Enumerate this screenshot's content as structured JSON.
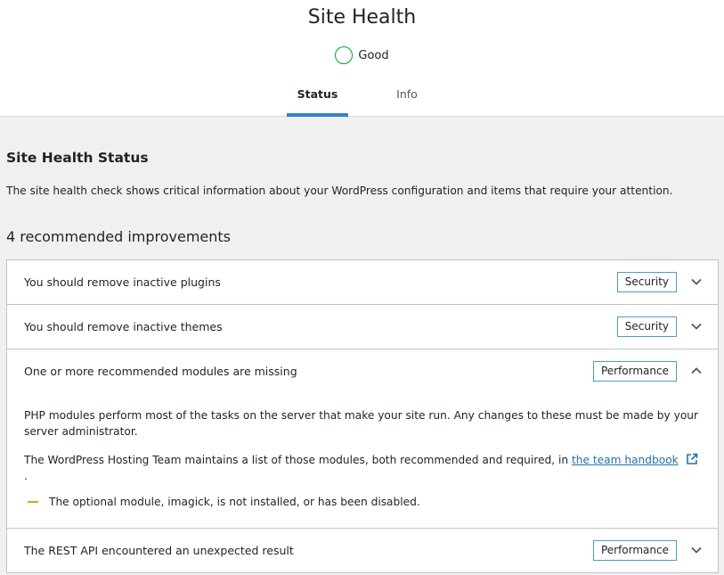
{
  "header": {
    "title": "Site Health",
    "status_label": "Good",
    "status_color": "#00a32a",
    "tabs": [
      {
        "label": "Status",
        "active": true
      },
      {
        "label": "Info",
        "active": false
      }
    ]
  },
  "main": {
    "section_title": "Site Health Status",
    "section_desc": "The site health check shows critical information about your WordPress configuration and items that require your attention.",
    "count_title": "4 recommended improvements",
    "items": [
      {
        "title": "You should remove inactive plugins",
        "badge": "Security",
        "expanded": false
      },
      {
        "title": "You should remove inactive themes",
        "badge": "Security",
        "expanded": false
      },
      {
        "title": "One or more recommended modules are missing",
        "badge": "Performance",
        "expanded": true,
        "body_p1": "PHP modules perform most of the tasks on the server that make your site run. Any changes to these must be made by your server administrator.",
        "body_p2_prefix": "The WordPress Hosting Team maintains a list of those modules, both recommended and required, in",
        "body_p2_link": "the team handbook",
        "body_p2_suffix": ".",
        "bullet": "The optional module, imagick, is not installed, or has been disabled."
      },
      {
        "title": "The REST API encountered an unexpected result",
        "badge": "Performance",
        "expanded": false
      }
    ]
  },
  "colors": {
    "accent": "#3582c4",
    "link": "#2271b1",
    "warning_dash": "#dba617",
    "badge_border": "#4a9ec2"
  }
}
